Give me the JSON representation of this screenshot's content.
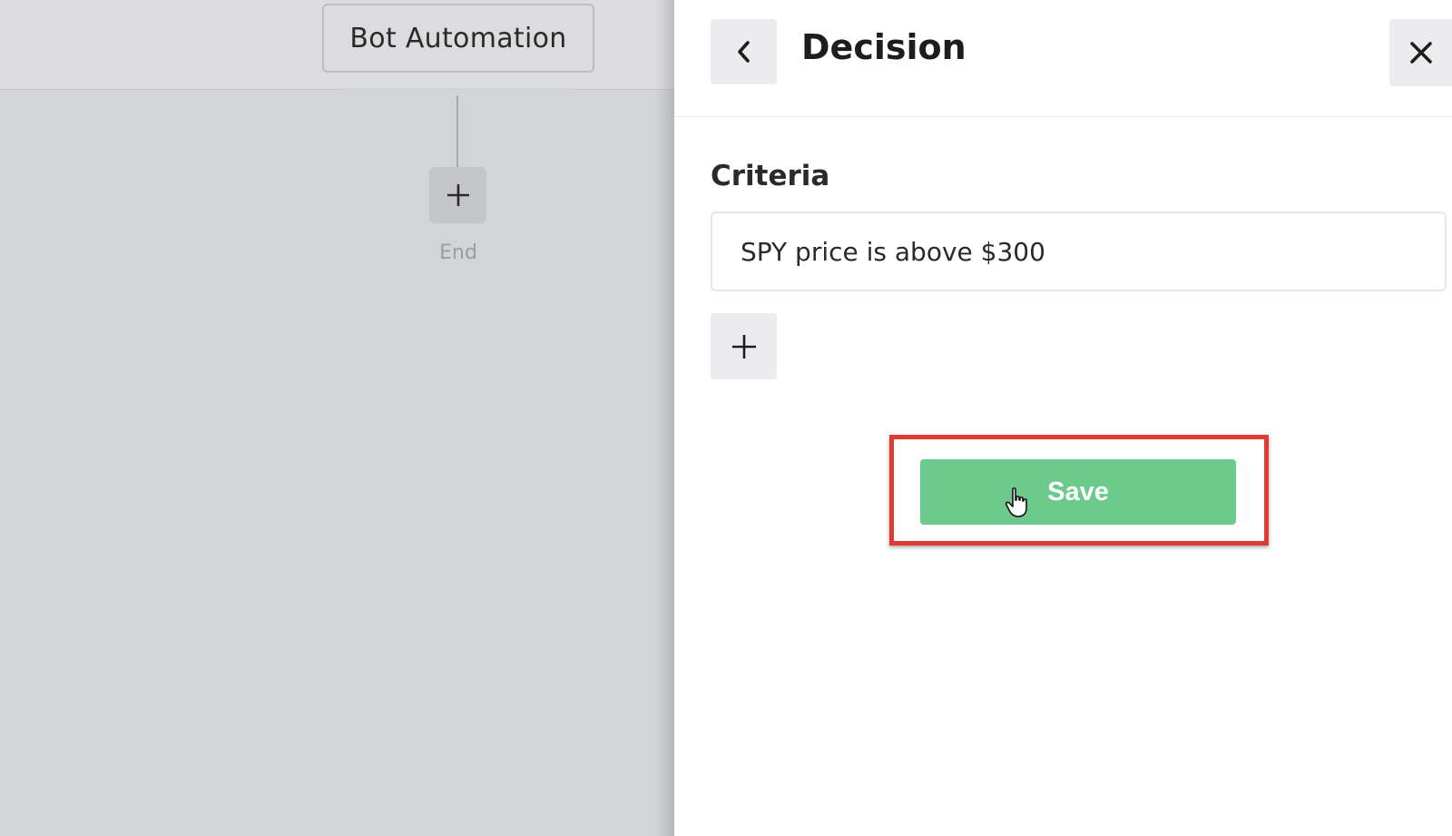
{
  "canvas": {
    "bot_node_label": "Bot Automation",
    "end_label": "End",
    "add_icon": "plus-icon"
  },
  "panel": {
    "title": "Decision",
    "back_icon": "chevron-left-icon",
    "close_icon": "close-icon",
    "criteria_label": "Criteria",
    "criteria_value": "SPY price is above $300",
    "add_criteria_icon": "plus-icon",
    "save_label": "Save"
  },
  "colors": {
    "save_button": "#6cca8c",
    "highlight": "#dd3b34",
    "canvas_overlay": "#d3d4d6"
  }
}
